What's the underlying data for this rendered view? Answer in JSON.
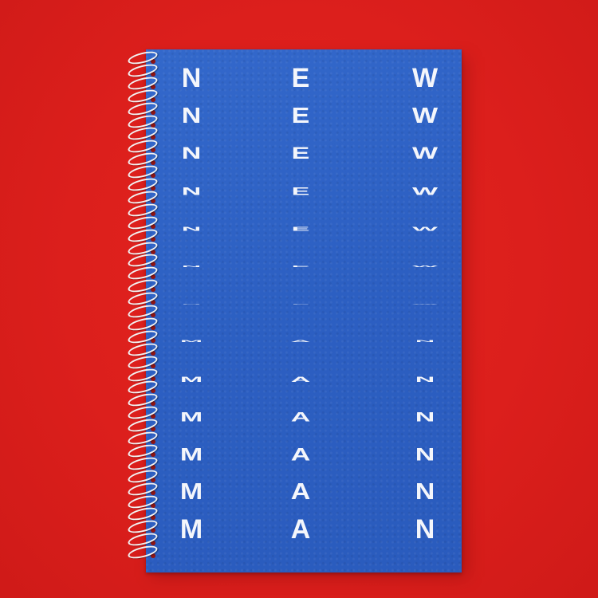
{
  "cover": {
    "column_1": [
      "N",
      "N",
      "N",
      "N",
      "N",
      "N",
      "N",
      "M",
      "M",
      "M",
      "M",
      "M",
      "M"
    ],
    "column_2": [
      "E",
      "E",
      "E",
      "E",
      "E",
      "E",
      "E",
      "A",
      "A",
      "A",
      "A",
      "A",
      "A"
    ],
    "column_3": [
      "W",
      "W",
      "W",
      "W",
      "W",
      "W",
      "W",
      "N",
      "N",
      "N",
      "N",
      "N",
      "N"
    ],
    "row_vertical_scale": [
      1.0,
      0.82,
      0.62,
      0.42,
      0.22,
      0.08,
      0.03,
      0.1,
      0.28,
      0.48,
      0.66,
      0.84,
      1.0
    ]
  },
  "colors": {
    "background": "#dc1f1c",
    "cover": "#2f63c6",
    "lettering": "#f4f6fb",
    "spiral": "#f2f2f2"
  },
  "icons": [
    "spiral-binding-icon"
  ]
}
